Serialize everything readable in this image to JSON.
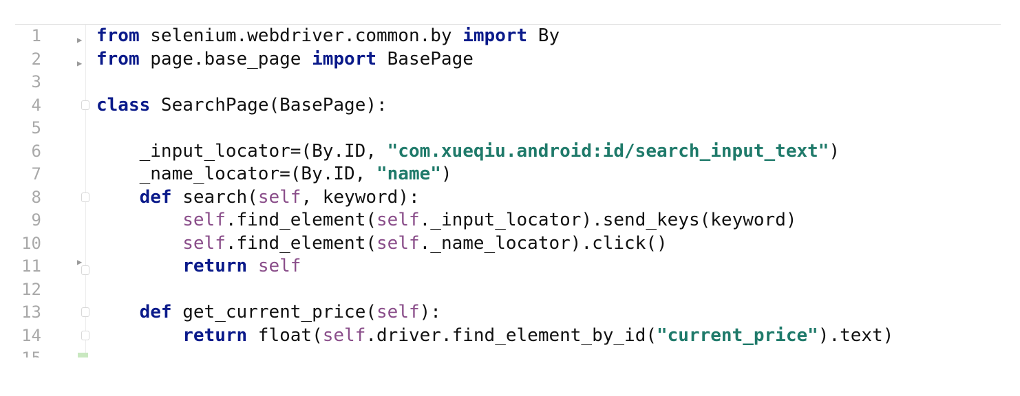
{
  "editor": {
    "lines": [
      {
        "num": "1",
        "tokens": [
          {
            "t": "from",
            "c": "kw"
          },
          {
            "t": " selenium.webdriver.common.by ",
            "c": ""
          },
          {
            "t": "import",
            "c": "kw"
          },
          {
            "t": " By",
            "c": ""
          }
        ],
        "marker": "arrow"
      },
      {
        "num": "2",
        "tokens": [
          {
            "t": "from",
            "c": "kw"
          },
          {
            "t": " page.base_page ",
            "c": ""
          },
          {
            "t": "import",
            "c": "kw"
          },
          {
            "t": " BasePage",
            "c": ""
          }
        ],
        "marker": "arrow"
      },
      {
        "num": "3",
        "tokens": [],
        "marker": ""
      },
      {
        "num": "4",
        "tokens": [
          {
            "t": "class",
            "c": "kw"
          },
          {
            "t": " SearchPage(BasePage):",
            "c": ""
          }
        ],
        "marker": "fold"
      },
      {
        "num": "5",
        "tokens": [],
        "marker": ""
      },
      {
        "num": "6",
        "tokens": [
          {
            "t": "    _input_locator=(By.ID, ",
            "c": ""
          },
          {
            "t": "\"com.xueqiu.android:id/search_input_text\"",
            "c": "str"
          },
          {
            "t": ")",
            "c": ""
          }
        ],
        "marker": ""
      },
      {
        "num": "7",
        "tokens": [
          {
            "t": "    _name_locator=(By.ID, ",
            "c": ""
          },
          {
            "t": "\"name\"",
            "c": "str"
          },
          {
            "t": ")",
            "c": ""
          }
        ],
        "marker": ""
      },
      {
        "num": "8",
        "tokens": [
          {
            "t": "    ",
            "c": ""
          },
          {
            "t": "def",
            "c": "kw"
          },
          {
            "t": " search(",
            "c": ""
          },
          {
            "t": "self",
            "c": "self"
          },
          {
            "t": ", keyword):",
            "c": ""
          }
        ],
        "marker": "fold"
      },
      {
        "num": "9",
        "tokens": [
          {
            "t": "        ",
            "c": ""
          },
          {
            "t": "self",
            "c": "self"
          },
          {
            "t": ".find_element(",
            "c": ""
          },
          {
            "t": "self",
            "c": "self"
          },
          {
            "t": "._input_locator).send_keys(keyword)",
            "c": ""
          }
        ],
        "marker": ""
      },
      {
        "num": "10",
        "tokens": [
          {
            "t": "        ",
            "c": ""
          },
          {
            "t": "self",
            "c": "self"
          },
          {
            "t": ".find_element(",
            "c": ""
          },
          {
            "t": "self",
            "c": "self"
          },
          {
            "t": "._name_locator).click()",
            "c": ""
          }
        ],
        "marker": ""
      },
      {
        "num": "11",
        "tokens": [
          {
            "t": "        ",
            "c": ""
          },
          {
            "t": "return",
            "c": "kw"
          },
          {
            "t": " ",
            "c": ""
          },
          {
            "t": "self",
            "c": "self"
          }
        ],
        "marker": "arrow-fold"
      },
      {
        "num": "12",
        "tokens": [],
        "marker": ""
      },
      {
        "num": "13",
        "tokens": [
          {
            "t": "    ",
            "c": ""
          },
          {
            "t": "def",
            "c": "kw"
          },
          {
            "t": " get_current_price(",
            "c": ""
          },
          {
            "t": "self",
            "c": "self"
          },
          {
            "t": "):",
            "c": ""
          }
        ],
        "marker": "fold"
      },
      {
        "num": "14",
        "tokens": [
          {
            "t": "        ",
            "c": ""
          },
          {
            "t": "return",
            "c": "kw"
          },
          {
            "t": " float(",
            "c": ""
          },
          {
            "t": "self",
            "c": "self"
          },
          {
            "t": ".driver.find_element_by_id(",
            "c": ""
          },
          {
            "t": "\"current_price\"",
            "c": "str"
          },
          {
            "t": ").text)",
            "c": ""
          }
        ],
        "marker": "fold"
      },
      {
        "num": "15",
        "tokens": [],
        "marker": "caret"
      }
    ]
  },
  "colors": {
    "keyword": "#0a1a8a",
    "string": "#1f7a6a",
    "self": "#8a4e8a",
    "line_number": "#a9a9a9",
    "caret_marker": "#c9e8c0"
  },
  "icons": {
    "arrow": "bookmark-arrow-icon",
    "fold": "fold-icon",
    "caret": "caret-line-icon"
  }
}
